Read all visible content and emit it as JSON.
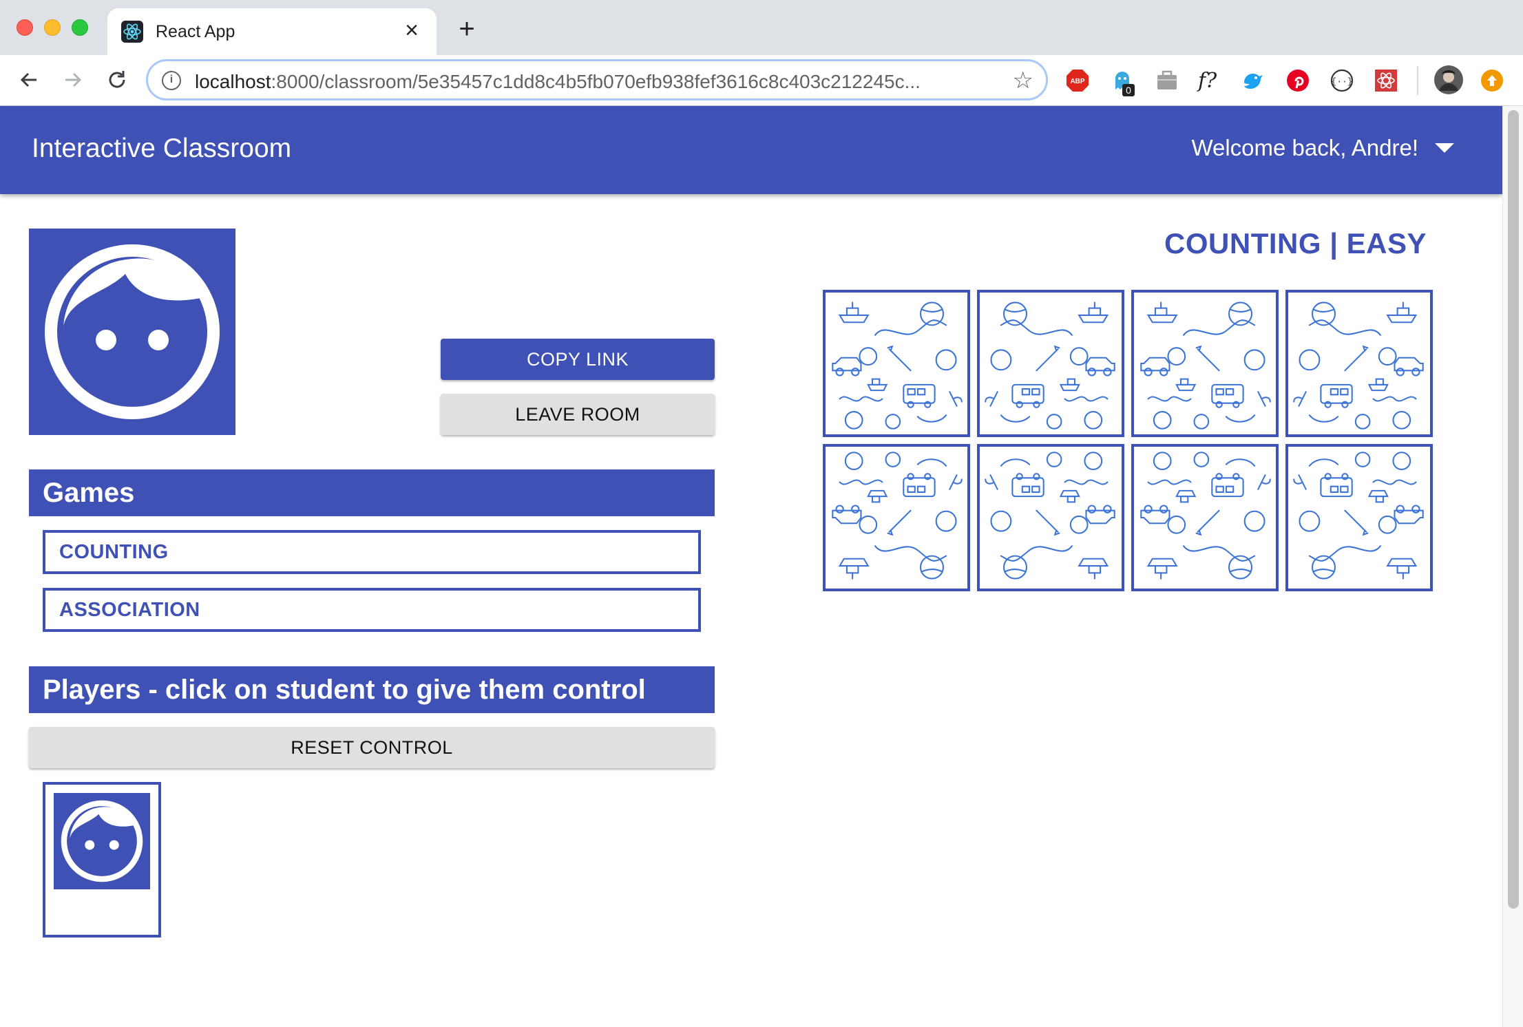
{
  "browser": {
    "tab_title": "React App",
    "url_host": "localhost",
    "url_path": ":8000/classroom/5e35457c1dd8c4b5fb070efb938fef3616c8c403c212245c...",
    "extensions": [
      "adblock-icon",
      "ghostery-icon",
      "toolbox-icon",
      "font-icon",
      "bird-icon",
      "pinterest-icon",
      "json-icon",
      "react-devtools-icon",
      "profile-avatar-icon",
      "update-icon"
    ],
    "ghostery_badge": "0",
    "adblock_label": "ABP",
    "font_label": "f?"
  },
  "app": {
    "title": "Interactive Classroom",
    "welcome": "Welcome back, Andre!",
    "accent_color": "#3f51b5"
  },
  "actions": {
    "copy_link": "COPY LINK",
    "leave_room": "LEAVE ROOM",
    "reset_control": "RESET CONTROL"
  },
  "games": {
    "header": "Games",
    "items": [
      {
        "label": "COUNTING"
      },
      {
        "label": "ASSOCIATION"
      }
    ]
  },
  "players": {
    "header": "Players - click on student to give them control"
  },
  "board": {
    "title": "COUNTING | EASY",
    "cards_count": 8
  }
}
